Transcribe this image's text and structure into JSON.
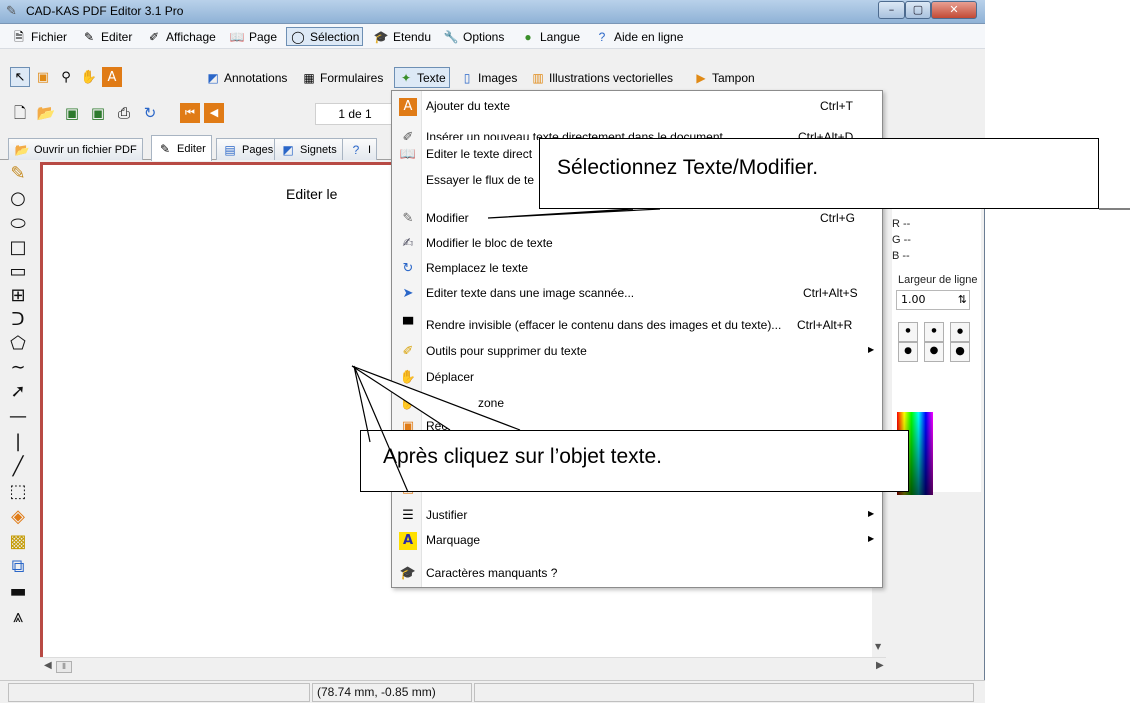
{
  "window": {
    "title": "CAD-KAS PDF Editor 3.1 Pro",
    "title_icon": "pen-icon",
    "controls": {
      "minimize": "–",
      "maximize": "▢",
      "close": "✕"
    }
  },
  "menubar": [
    {
      "label": "Fichier",
      "icon": "document-icon"
    },
    {
      "label": "Editer",
      "icon": "pen-icon"
    },
    {
      "label": "Affichage",
      "icon": "eye-icon"
    },
    {
      "label": "Page",
      "icon": "book-icon"
    },
    {
      "label": "Sélection",
      "icon": "lasso-icon",
      "pressed": true
    },
    {
      "label": "Etendu",
      "icon": "hat-icon"
    },
    {
      "label": "Options",
      "icon": "wrench-icon"
    },
    {
      "label": "Langue",
      "icon": "globe-icon"
    },
    {
      "label": "Aide en ligne",
      "icon": "help-icon"
    }
  ],
  "toolbar2": {
    "categories": [
      {
        "label": "Annotations",
        "icon": "annotation-icon"
      },
      {
        "label": "Formulaires",
        "icon": "form-icon"
      },
      {
        "label": "Texte",
        "icon": "text-icon",
        "pressed": true
      },
      {
        "label": "Images",
        "icon": "image-icon"
      },
      {
        "label": "Illustrations vectorielles",
        "icon": "vector-icon"
      },
      {
        "label": "Tampon",
        "icon": "stamp-icon"
      }
    ]
  },
  "toolbar3": {
    "page_indicator": "1 de 1"
  },
  "tabs": [
    {
      "label": "Ouvrir un fichier PDF",
      "icon": "open-folder-icon"
    },
    {
      "label": "Editer",
      "icon": "pen-icon",
      "active": true
    },
    {
      "label": "Pages",
      "icon": "pages-icon"
    },
    {
      "label": "Signets",
      "icon": "bookmark-icon"
    },
    {
      "label": "I",
      "icon": "info-icon"
    }
  ],
  "canvas": {
    "visible_text": "Editer le"
  },
  "right_panel": {
    "r_label": "R --",
    "g_label": "G --",
    "b_label": "B --",
    "line_width_label": "Largeur de ligne",
    "line_width_value": "1.00"
  },
  "status": {
    "coordinates": "(78.74 mm, -0.85 mm)"
  },
  "text_menu": {
    "items": [
      {
        "label": "Ajouter du texte",
        "shortcut": "Ctrl+T",
        "icon": "add-text-icon"
      },
      {
        "label": "Insérer un nouveau texte directement dans le document",
        "shortcut": "Ctrl+Alt+D",
        "icon": "insert-text-icon"
      },
      {
        "label": "Editer le texte direct",
        "shortcut": "",
        "icon": "book-icon"
      },
      {
        "label": "Essayer le flux de te",
        "shortcut": "",
        "icon": ""
      },
      {
        "label": "Modifier",
        "shortcut": "Ctrl+G",
        "icon": "pen-icon"
      },
      {
        "label": "Modifier le bloc de texte",
        "shortcut": "",
        "icon": "edit-block-icon"
      },
      {
        "label": "Remplacez le texte",
        "shortcut": "",
        "icon": "replace-icon"
      },
      {
        "label": "Editer texte dans une image scannée...",
        "shortcut": "Ctrl+Alt+S",
        "icon": "scan-icon"
      },
      {
        "label": "Rendre invisible (effacer le contenu dans des images et du texte)...",
        "shortcut": "Ctrl+Alt+R",
        "icon": "invisible-text-icon"
      },
      {
        "label": "Outils pour supprimer du texte",
        "shortcut": "",
        "icon": "eraser-icon",
        "submenu": true
      },
      {
        "label": "Déplacer",
        "shortcut": "",
        "icon": "move-icon"
      },
      {
        "label": "zone",
        "shortcut": "",
        "icon": "hand-icon"
      },
      {
        "label": "Rec",
        "shortcut": "",
        "icon": "rect-icon"
      },
      {
        "label": "",
        "shortcut": "",
        "icon": ""
      },
      {
        "label": "",
        "shortcut": "",
        "icon": ""
      },
      {
        "label": "Justifier",
        "shortcut": "",
        "icon": "justify-icon",
        "submenu": true
      },
      {
        "label": "Marquage",
        "shortcut": "",
        "icon": "highlight-icon",
        "submenu": true
      },
      {
        "label": "Caractères manquants ?",
        "shortcut": "",
        "icon": "hat-icon"
      }
    ]
  },
  "callouts": {
    "top": "Sélectionnez Texte/Modifier.",
    "bottom": "Après cliquez sur l’objet texte."
  }
}
